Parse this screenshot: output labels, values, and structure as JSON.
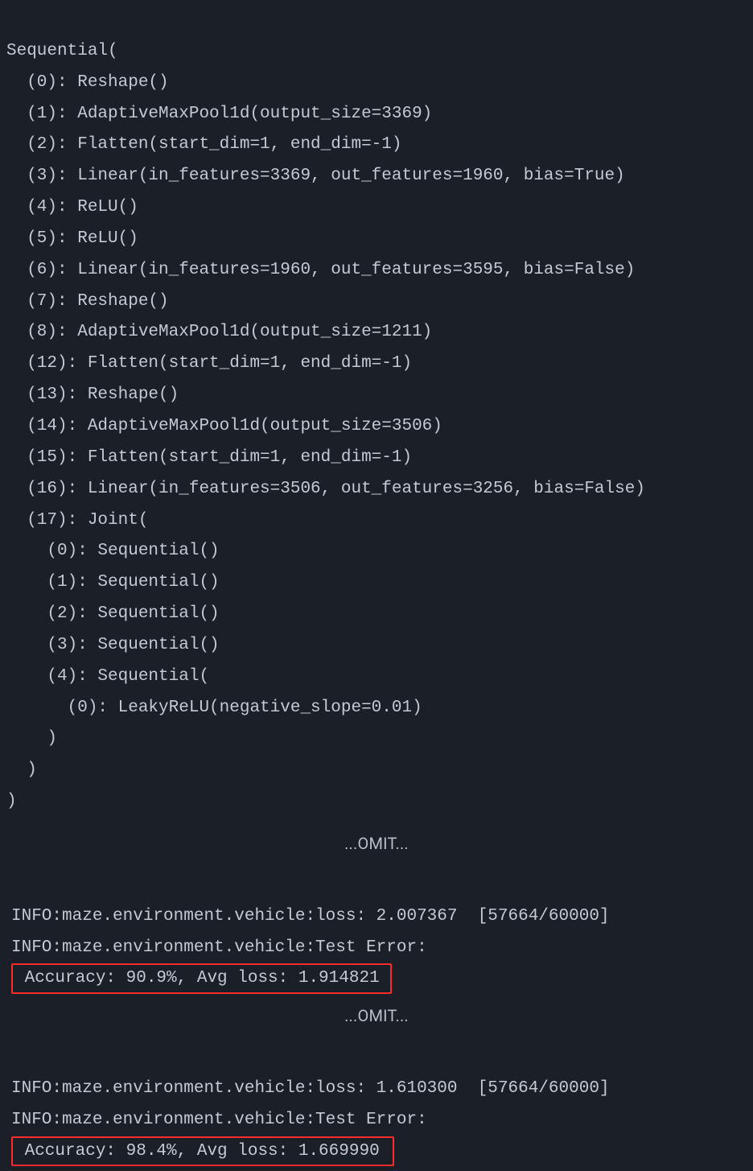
{
  "model": {
    "header": "Sequential(",
    "lines": [
      "  (0): Reshape()",
      "  (1): AdaptiveMaxPool1d(output_size=3369)",
      "  (2): Flatten(start_dim=1, end_dim=-1)",
      "  (3): Linear(in_features=3369, out_features=1960, bias=True)",
      "  (4): ReLU()",
      "  (5): ReLU()",
      "  (6): Linear(in_features=1960, out_features=3595, bias=False)",
      "  (7): Reshape()",
      "  (8): AdaptiveMaxPool1d(output_size=1211)",
      "  (12): Flatten(start_dim=1, end_dim=-1)",
      "  (13): Reshape()",
      "  (14): AdaptiveMaxPool1d(output_size=3506)",
      "  (15): Flatten(start_dim=1, end_dim=-1)",
      "  (16): Linear(in_features=3506, out_features=3256, bias=False)",
      "  (17): Joint(",
      "    (0): Sequential()",
      "    (1): Sequential()",
      "    (2): Sequential()",
      "    (3): Sequential()",
      "    (4): Sequential(",
      "      (0): LeakyReLU(negative_slope=0.01)",
      "    )",
      "  )",
      ")"
    ]
  },
  "omit_label": "...OMIT...",
  "log1": {
    "loss_line": "INFO:maze.environment.vehicle:loss: 2.007367  [57664/60000]",
    "test_header": "INFO:maze.environment.vehicle:Test Error: ",
    "accuracy": " Accuracy: 90.9%, Avg loss: 1.914821 "
  },
  "log2": {
    "loss_line": "INFO:maze.environment.vehicle:loss: 1.610300  [57664/60000]",
    "test_header": "INFO:maze.environment.vehicle:Test Error: ",
    "accuracy": " Accuracy: 98.4%, Avg loss: 1.669990 "
  }
}
